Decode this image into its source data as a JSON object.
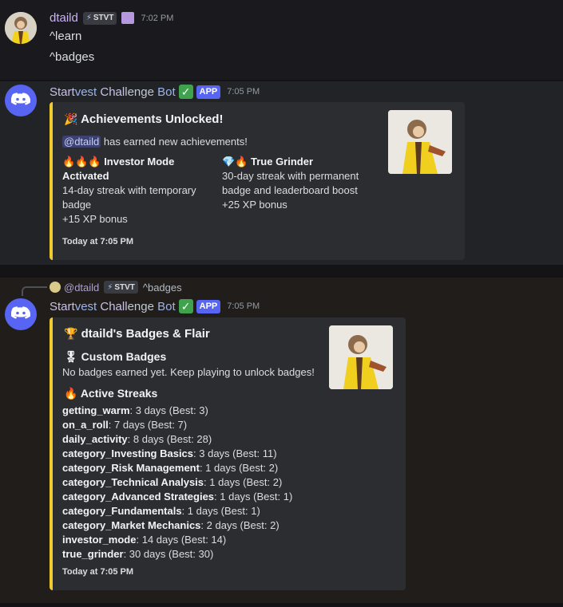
{
  "message1": {
    "username": "dtaild",
    "tag": "STVT",
    "time": "7:02 PM",
    "lines": [
      "^learn",
      "^badges"
    ]
  },
  "message2": {
    "bot_name_parts": [
      "Start",
      "vest",
      " Chal",
      "lenge",
      " Bot"
    ],
    "app_label": "APP",
    "time": "7:05 PM",
    "embed": {
      "title": "Achievements Unlocked!",
      "mention": "@dtaild",
      "mention_rest": "has earned new achievements!",
      "field1": {
        "icon": "🔥🔥🔥",
        "name_line1": "Investor Mode",
        "name_line2": "Activated",
        "desc": [
          "14-day streak with temporary",
          "badge",
          "+15 XP bonus"
        ]
      },
      "field2": {
        "icon": "💎🔥",
        "name": "True Grinder",
        "desc": [
          "30-day streak with permanent",
          "badge and leaderboard boost",
          "+25 XP bonus"
        ]
      },
      "footer": "Today at 7:05 PM"
    }
  },
  "message3": {
    "reply": {
      "mention": "@dtaild",
      "tag": "STVT",
      "text": "^badges"
    },
    "bot_name_parts": [
      "Start",
      "vest",
      " Chal",
      "lenge",
      " Bot"
    ],
    "app_label": "APP",
    "time": "7:05 PM",
    "embed": {
      "title": "dtaild's Badges & Flair",
      "section1_title": "Custom Badges",
      "section1_text": "No badges earned yet. Keep playing to unlock badges!",
      "section2_title": "Active Streaks",
      "streaks": [
        {
          "key": "getting_warm",
          "val": ": 3 days (Best: 3)"
        },
        {
          "key": "on_a_roll",
          "val": ": 7 days (Best: 7)"
        },
        {
          "key": "daily_activity",
          "val": ": 8 days (Best: 28)"
        },
        {
          "key": "category_Investing Basics",
          "val": ": 3 days (Best: 11)"
        },
        {
          "key": "category_Risk Management",
          "val": ": 1 days (Best: 2)"
        },
        {
          "key": "category_Technical Analysis",
          "val": ": 1 days (Best: 2)"
        },
        {
          "key": "category_Advanced Strategies",
          "val": ": 1 days (Best: 1)"
        },
        {
          "key": "category_Fundamentals",
          "val": ": 1 days (Best: 1)"
        },
        {
          "key": "category_Market Mechanics",
          "val": ": 2 days (Best: 2)"
        },
        {
          "key": "investor_mode",
          "val": ": 14 days (Best: 14)"
        },
        {
          "key": "true_grinder",
          "val": ": 30 days (Best: 30)"
        }
      ],
      "footer": "Today at 7:05 PM"
    }
  }
}
